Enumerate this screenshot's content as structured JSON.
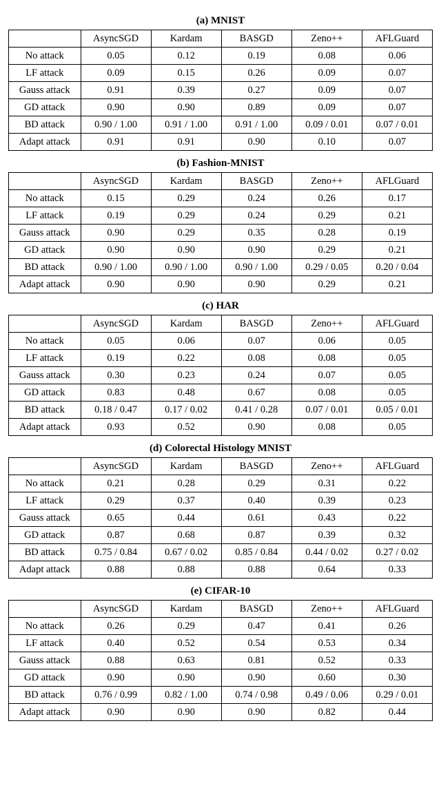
{
  "methods": [
    "AsyncSGD",
    "Kardam",
    "BASGD",
    "Zeno++",
    "AFLGuard"
  ],
  "attacks": [
    "No attack",
    "LF attack",
    "Gauss attack",
    "GD attack",
    "BD attack",
    "Adapt attack"
  ],
  "tables": [
    {
      "caption": "(a) MNIST",
      "rows": [
        [
          "0.05",
          "0.12",
          "0.19",
          "0.08",
          "0.06"
        ],
        [
          "0.09",
          "0.15",
          "0.26",
          "0.09",
          "0.07"
        ],
        [
          "0.91",
          "0.39",
          "0.27",
          "0.09",
          "0.07"
        ],
        [
          "0.90",
          "0.90",
          "0.89",
          "0.09",
          "0.07"
        ],
        [
          "0.90 / 1.00",
          "0.91 / 1.00",
          "0.91 / 1.00",
          "0.09 / 0.01",
          "0.07 / 0.01"
        ],
        [
          "0.91",
          "0.91",
          "0.90",
          "0.10",
          "0.07"
        ]
      ]
    },
    {
      "caption": "(b) Fashion-MNIST",
      "rows": [
        [
          "0.15",
          "0.29",
          "0.24",
          "0.26",
          "0.17"
        ],
        [
          "0.19",
          "0.29",
          "0.24",
          "0.29",
          "0.21"
        ],
        [
          "0.90",
          "0.29",
          "0.35",
          "0.28",
          "0.19"
        ],
        [
          "0.90",
          "0.90",
          "0.90",
          "0.29",
          "0.21"
        ],
        [
          "0.90 / 1.00",
          "0.90 / 1.00",
          "0.90 / 1.00",
          "0.29 / 0.05",
          "0.20 / 0.04"
        ],
        [
          "0.90",
          "0.90",
          "0.90",
          "0.29",
          "0.21"
        ]
      ]
    },
    {
      "caption": "(c) HAR",
      "rows": [
        [
          "0.05",
          "0.06",
          "0.07",
          "0.06",
          "0.05"
        ],
        [
          "0.19",
          "0.22",
          "0.08",
          "0.08",
          "0.05"
        ],
        [
          "0.30",
          "0.23",
          "0.24",
          "0.07",
          "0.05"
        ],
        [
          "0.83",
          "0.48",
          "0.67",
          "0.08",
          "0.05"
        ],
        [
          "0.18 / 0.47",
          "0.17 / 0.02",
          "0.41 / 0.28",
          "0.07 / 0.01",
          "0.05 / 0.01"
        ],
        [
          "0.93",
          "0.52",
          "0.90",
          "0.08",
          "0.05"
        ]
      ]
    },
    {
      "caption": "(d) Colorectal Histology MNIST",
      "rows": [
        [
          "0.21",
          "0.28",
          "0.29",
          "0.31",
          "0.22"
        ],
        [
          "0.29",
          "0.37",
          "0.40",
          "0.39",
          "0.23"
        ],
        [
          "0.65",
          "0.44",
          "0.61",
          "0.43",
          "0.22"
        ],
        [
          "0.87",
          "0.68",
          "0.87",
          "0.39",
          "0.32"
        ],
        [
          "0.75 / 0.84",
          "0.67 / 0.02",
          "0.85 / 0.84",
          "0.44 / 0.02",
          "0.27 / 0.02"
        ],
        [
          "0.88",
          "0.88",
          "0.88",
          "0.64",
          "0.33"
        ]
      ]
    },
    {
      "caption": "(e) CIFAR-10",
      "rows": [
        [
          "0.26",
          "0.29",
          "0.47",
          "0.41",
          "0.26"
        ],
        [
          "0.40",
          "0.52",
          "0.54",
          "0.53",
          "0.34"
        ],
        [
          "0.88",
          "0.63",
          "0.81",
          "0.52",
          "0.33"
        ],
        [
          "0.90",
          "0.90",
          "0.90",
          "0.60",
          "0.30"
        ],
        [
          "0.76 / 0.99",
          "0.82 / 1.00",
          "0.74 / 0.98",
          "0.49 / 0.06",
          "0.29 / 0.01"
        ],
        [
          "0.90",
          "0.90",
          "0.90",
          "0.82",
          "0.44"
        ]
      ]
    }
  ],
  "chart_data": [
    {
      "type": "table",
      "title": "(a) MNIST",
      "columns": [
        "",
        "AsyncSGD",
        "Kardam",
        "BASGD",
        "Zeno++",
        "AFLGuard"
      ],
      "rows": [
        [
          "No attack",
          0.05,
          0.12,
          0.19,
          0.08,
          0.06
        ],
        [
          "LF attack",
          0.09,
          0.15,
          0.26,
          0.09,
          0.07
        ],
        [
          "Gauss attack",
          0.91,
          0.39,
          0.27,
          0.09,
          0.07
        ],
        [
          "GD attack",
          0.9,
          0.9,
          0.89,
          0.09,
          0.07
        ],
        [
          "BD attack",
          "0.90 / 1.00",
          "0.91 / 1.00",
          "0.91 / 1.00",
          "0.09 / 0.01",
          "0.07 / 0.01"
        ],
        [
          "Adapt attack",
          0.91,
          0.91,
          0.9,
          0.1,
          0.07
        ]
      ]
    },
    {
      "type": "table",
      "title": "(b) Fashion-MNIST",
      "columns": [
        "",
        "AsyncSGD",
        "Kardam",
        "BASGD",
        "Zeno++",
        "AFLGuard"
      ],
      "rows": [
        [
          "No attack",
          0.15,
          0.29,
          0.24,
          0.26,
          0.17
        ],
        [
          "LF attack",
          0.19,
          0.29,
          0.24,
          0.29,
          0.21
        ],
        [
          "Gauss attack",
          0.9,
          0.29,
          0.35,
          0.28,
          0.19
        ],
        [
          "GD attack",
          0.9,
          0.9,
          0.9,
          0.29,
          0.21
        ],
        [
          "BD attack",
          "0.90 / 1.00",
          "0.90 / 1.00",
          "0.90 / 1.00",
          "0.29 / 0.05",
          "0.20 / 0.04"
        ],
        [
          "Adapt attack",
          0.9,
          0.9,
          0.9,
          0.29,
          0.21
        ]
      ]
    },
    {
      "type": "table",
      "title": "(c) HAR",
      "columns": [
        "",
        "AsyncSGD",
        "Kardam",
        "BASGD",
        "Zeno++",
        "AFLGuard"
      ],
      "rows": [
        [
          "No attack",
          0.05,
          0.06,
          0.07,
          0.06,
          0.05
        ],
        [
          "LF attack",
          0.19,
          0.22,
          0.08,
          0.08,
          0.05
        ],
        [
          "Gauss attack",
          0.3,
          0.23,
          0.24,
          0.07,
          0.05
        ],
        [
          "GD attack",
          0.83,
          0.48,
          0.67,
          0.08,
          0.05
        ],
        [
          "BD attack",
          "0.18 / 0.47",
          "0.17 / 0.02",
          "0.41 / 0.28",
          "0.07 / 0.01",
          "0.05 / 0.01"
        ],
        [
          "Adapt attack",
          0.93,
          0.52,
          0.9,
          0.08,
          0.05
        ]
      ]
    },
    {
      "type": "table",
      "title": "(d) Colorectal Histology MNIST",
      "columns": [
        "",
        "AsyncSGD",
        "Kardam",
        "BASGD",
        "Zeno++",
        "AFLGuard"
      ],
      "rows": [
        [
          "No attack",
          0.21,
          0.28,
          0.29,
          0.31,
          0.22
        ],
        [
          "LF attack",
          0.29,
          0.37,
          0.4,
          0.39,
          0.23
        ],
        [
          "Gauss attack",
          0.65,
          0.44,
          0.61,
          0.43,
          0.22
        ],
        [
          "GD attack",
          0.87,
          0.68,
          0.87,
          0.39,
          0.32
        ],
        [
          "BD attack",
          "0.75 / 0.84",
          "0.67 / 0.02",
          "0.85 / 0.84",
          "0.44 / 0.02",
          "0.27 / 0.02"
        ],
        [
          "Adapt attack",
          0.88,
          0.88,
          0.88,
          0.64,
          0.33
        ]
      ]
    },
    {
      "type": "table",
      "title": "(e) CIFAR-10",
      "columns": [
        "",
        "AsyncSGD",
        "Kardam",
        "BASGD",
        "Zeno++",
        "AFLGuard"
      ],
      "rows": [
        [
          "No attack",
          0.26,
          0.29,
          0.47,
          0.41,
          0.26
        ],
        [
          "LF attack",
          0.4,
          0.52,
          0.54,
          0.53,
          0.34
        ],
        [
          "Gauss attack",
          0.88,
          0.63,
          0.81,
          0.52,
          0.33
        ],
        [
          "GD attack",
          0.9,
          0.9,
          0.9,
          0.6,
          0.3
        ],
        [
          "BD attack",
          "0.76 / 0.99",
          "0.82 / 1.00",
          "0.74 / 0.98",
          "0.49 / 0.06",
          "0.29 / 0.01"
        ],
        [
          "Adapt attack",
          0.9,
          0.9,
          0.9,
          0.82,
          0.44
        ]
      ]
    }
  ]
}
